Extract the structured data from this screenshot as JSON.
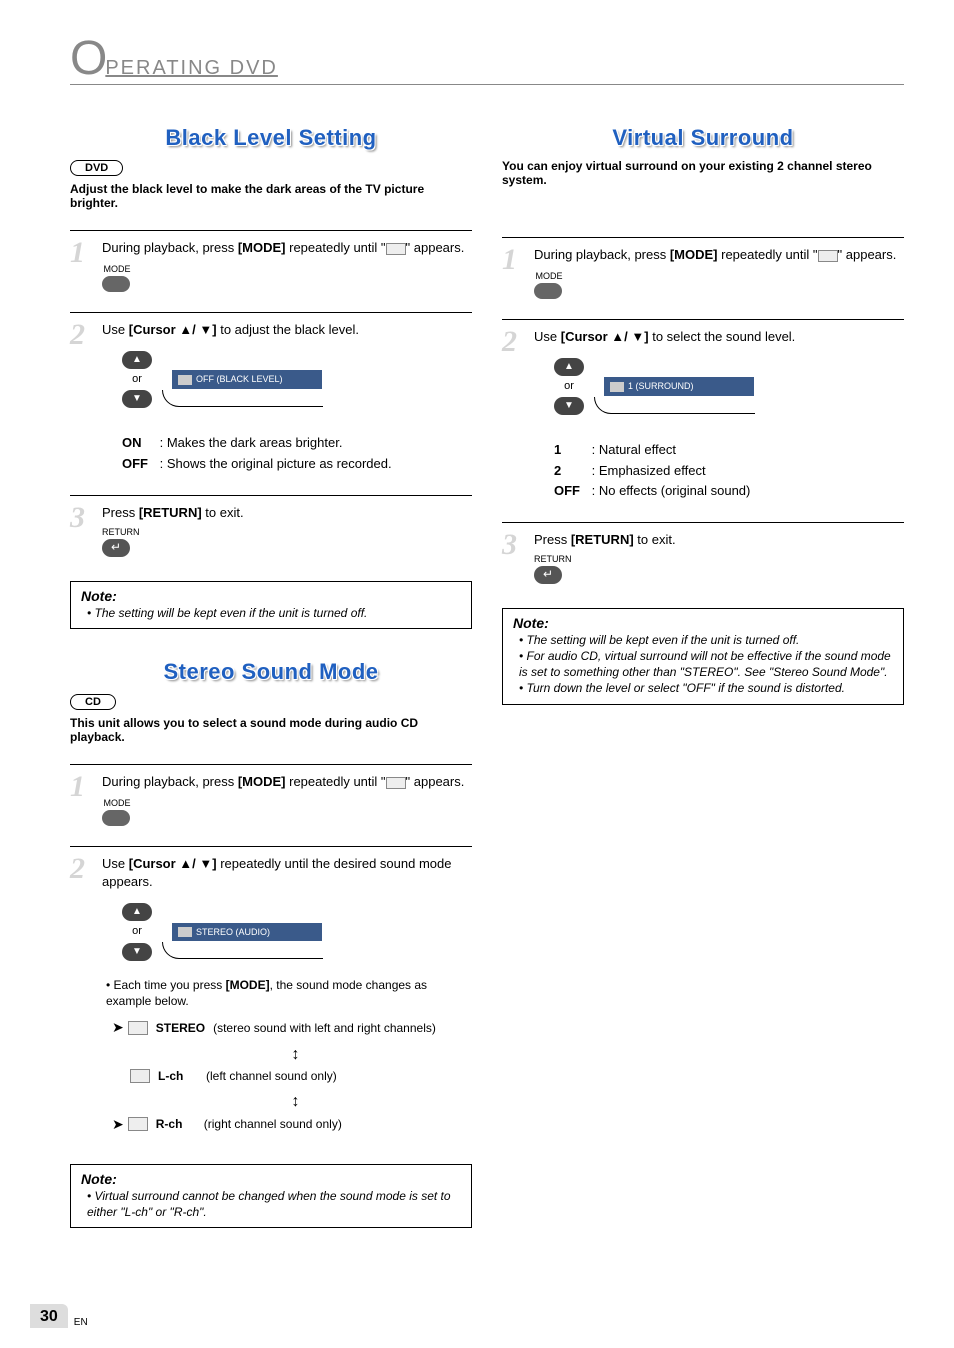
{
  "header": {
    "o": "O",
    "rest": "PERATING  DVD"
  },
  "page_number": "30",
  "page_lang": "EN",
  "black_level": {
    "title": "Black Level Setting",
    "badge": "DVD",
    "intro": "Adjust the black level to make the dark areas of the TV picture brighter.",
    "step1": {
      "text_a": "During playback, press ",
      "mode": "[MODE]",
      "text_b": " repeatedly until \"",
      "text_c": "\" appears.",
      "mode_label": "MODE"
    },
    "step2": {
      "text_a": "Use ",
      "cursor": "[Cursor ▲/ ▼]",
      "text_b": " to adjust the black level.",
      "or": "or",
      "osd": "OFF  (BLACK LEVEL)",
      "on_key": "ON",
      "on_desc": ": Makes the dark areas brighter.",
      "off_key": "OFF",
      "off_desc": ": Shows the original picture as recorded."
    },
    "step3": {
      "text_a": "Press ",
      "return": "[RETURN]",
      "text_b": " to exit.",
      "return_label": "RETURN"
    },
    "note_title": "Note:",
    "note_items": [
      "The setting will be kept even if the unit is turned off."
    ]
  },
  "stereo": {
    "title": "Stereo Sound Mode",
    "badge": "CD",
    "intro": "This unit allows you to select a sound mode during audio CD playback.",
    "step1": {
      "text_a": "During playback, press ",
      "mode": "[MODE]",
      "text_b": " repeatedly until \"",
      "text_c": "\" appears.",
      "mode_label": "MODE"
    },
    "step2": {
      "text_a": "Use ",
      "cursor": "[Cursor ▲/ ▼]",
      "text_b": " repeatedly until the desired sound mode appears.",
      "or": "or",
      "osd": "STEREO (AUDIO)",
      "bullet_a": "Each time you press ",
      "bullet_mode": "[MODE]",
      "bullet_b": ", the sound mode changes as example below.",
      "cycle": [
        {
          "key": "STEREO",
          "desc": "(stereo sound with left and right channels)"
        },
        {
          "key": "L-ch",
          "desc": "(left channel sound only)"
        },
        {
          "key": "R-ch",
          "desc": "(right channel sound only)"
        }
      ]
    },
    "note_title": "Note:",
    "note_items": [
      "Virtual surround cannot be changed when the sound mode is set to either \"L-ch\" or \"R-ch\"."
    ]
  },
  "virtual": {
    "title": "Virtual Surround",
    "intro": "You can enjoy virtual surround on your existing 2 channel stereo system.",
    "step1": {
      "text_a": "During playback, press ",
      "mode": "[MODE]",
      "text_b": " repeatedly until \"",
      "text_c": "\" appears.",
      "mode_label": "MODE"
    },
    "step2": {
      "text_a": "Use ",
      "cursor": "[Cursor ▲/ ▼]",
      "text_b": " to select the sound level.",
      "or": "or",
      "osd": "1  (SURROUND)",
      "k1": "1",
      "d1": ": Natural effect",
      "k2": "2",
      "d2": ": Emphasized effect",
      "koff": "OFF",
      "doff": ": No effects (original sound)"
    },
    "step3": {
      "text_a": "Press ",
      "return": "[RETURN]",
      "text_b": " to exit.",
      "return_label": "RETURN"
    },
    "note_title": "Note:",
    "note_items": [
      "The setting will be kept even if the unit is turned off.",
      "For audio CD, virtual surround will not be effective if the sound mode is set to something other than \"STEREO\". See \"Stereo Sound Mode\".",
      "Turn down the level or select \"OFF\" if the sound is distorted."
    ]
  }
}
